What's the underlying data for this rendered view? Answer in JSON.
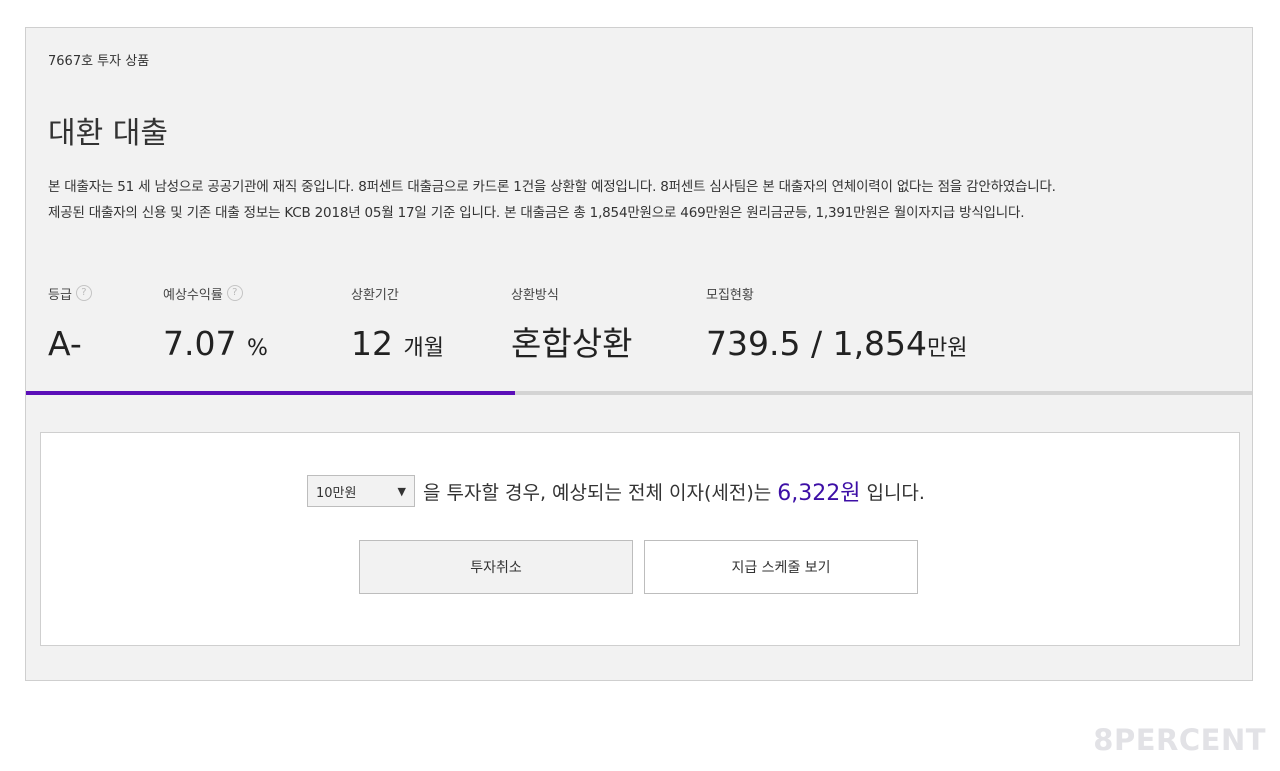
{
  "product": {
    "number": "7667호 투자 상품",
    "title": "대환 대출",
    "description": [
      "본 대출자는 51 세 남성으로 공공기관에 재직 중입니다. 8퍼센트 대출금으로 카드론 1건을 상환할 예정입니다. 8퍼센트 심사팀은 본 대출자의 연체이력이 없다는 점을 감안하였습니다.",
      "제공된 대출자의 신용 및 기존 대출 정보는 KCB 2018년 05월 17일 기준 입니다. 본 대출금은 총 1,854만원으로 469만원은 원리금균등, 1,391만원은 월이자지급 방식입니다."
    ]
  },
  "stats": {
    "grade": {
      "label": "등급",
      "value": "A-",
      "help_icon": "question-circle-icon"
    },
    "yield": {
      "label": "예상수익률",
      "value": "7.07",
      "unit": "%",
      "help_icon": "question-circle-icon"
    },
    "period": {
      "label": "상환기간",
      "value": "12",
      "unit": "개월"
    },
    "method": {
      "label": "상환방식",
      "value": "혼합상환"
    },
    "funding": {
      "label": "모집현황",
      "value": "739.5 / 1,854",
      "unit": "만원"
    }
  },
  "progress": {
    "fraction": 0.399,
    "color": "#5b0fb8"
  },
  "calculator": {
    "selected_amount": "10만원",
    "caret_icon": "triangle-down-icon",
    "text_before": "을 투자할 경우, 예상되는 전체 이자(세전)는",
    "interest": "6,322원",
    "text_after": "입니다.",
    "interest_color": "#3d0fa6"
  },
  "buttons": {
    "cancel": "투자취소",
    "schedule": "지급 스케줄 보기"
  },
  "brand": {
    "logo_text": "8PERCENT"
  }
}
